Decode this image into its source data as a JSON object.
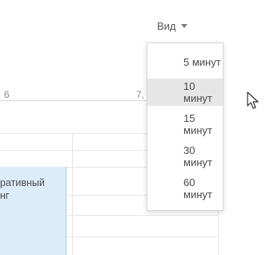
{
  "calendar": {
    "day_headers": [
      "6",
      "7,"
    ],
    "event": {
      "text_line1": "ративный",
      "text_line2": "нг"
    },
    "colors": {
      "event_fill": "#dcecfb",
      "event_border": "#a9cdee",
      "selected_item": "#e6e6e6"
    }
  },
  "view_menu": {
    "button_label": "Вид",
    "caret_icon": "caret-down-icon",
    "items": [
      {
        "label": "5 минут"
      },
      {
        "label": "10 минут"
      },
      {
        "label": "15 минут"
      },
      {
        "label": "30 минут"
      },
      {
        "label": "60 минут"
      }
    ],
    "hovered_index": 1
  },
  "pointer": {
    "icon": "arrow-cursor-icon"
  }
}
